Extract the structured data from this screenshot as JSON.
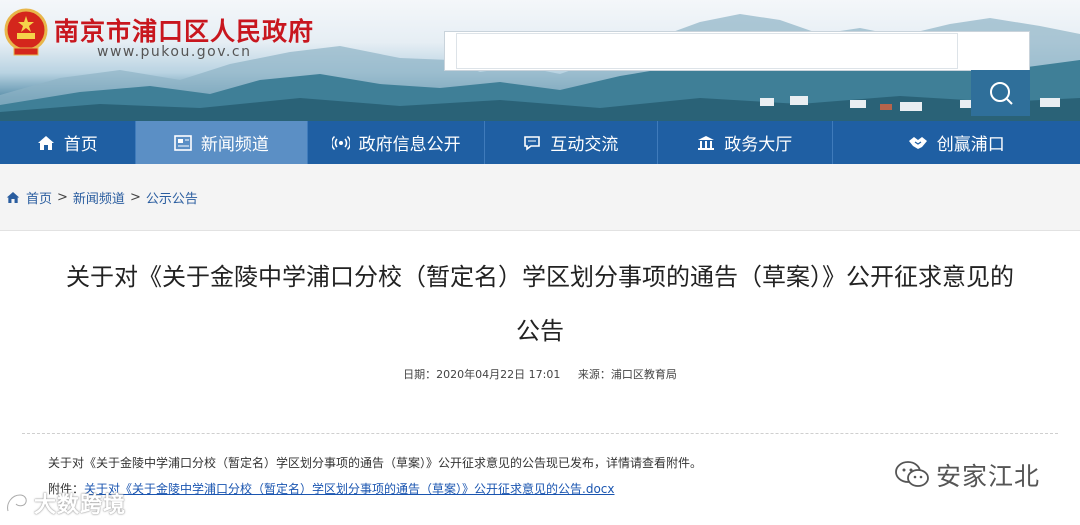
{
  "header": {
    "site_title": "南京市浦口区人民政府",
    "site_domain": "www.pukou.gov.cn",
    "search_placeholder": ""
  },
  "nav": {
    "items": [
      {
        "label": "首页",
        "icon": "home-icon"
      },
      {
        "label": "新闻频道",
        "icon": "newspaper-icon",
        "active": true
      },
      {
        "label": "政府信息公开",
        "icon": "broadcast-icon"
      },
      {
        "label": "互动交流",
        "icon": "chat-icon"
      },
      {
        "label": "政务大厅",
        "icon": "hall-icon"
      },
      {
        "label": "创赢浦口",
        "icon": "handshake-icon"
      }
    ]
  },
  "breadcrumb": {
    "items": [
      "首页",
      "新闻频道",
      "公示公告"
    ],
    "separator": ">"
  },
  "article": {
    "title_line1": "关于对《关于金陵中学浦口分校（暂定名）学区划分事项的通告（草案）》公开征求意见的",
    "title_line2": "公告",
    "date": "日期：2020年04月22日 17:01",
    "source": "来源：浦口区教育局",
    "body": "关于对《关于金陵中学浦口分校（暂定名）学区划分事项的通告（草案）》公开征求意见的公告现已发布，详情请查看附件。",
    "attachment_label": "附件：",
    "attachment_link": "关于对《关于金陵中学浦口分校（暂定名）学区划分事项的通告（草案）》公开征求意见的公告.docx"
  },
  "watermarks": {
    "right_text": "安家江北",
    "left_text": "大数跨境"
  },
  "colors": {
    "nav_bg": "#1f5fa3",
    "nav_active": "#5b8fc5",
    "title_red": "#c8161e",
    "link_blue": "#1a55b0"
  }
}
